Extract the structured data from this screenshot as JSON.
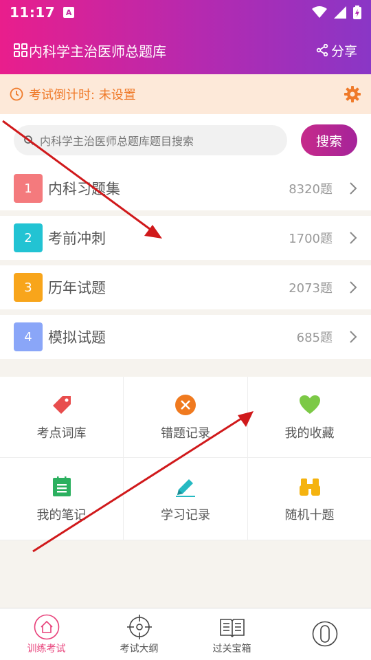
{
  "status_bar": {
    "time": "11:17",
    "a_badge": "A"
  },
  "header": {
    "title": "内科学主治医师总题库",
    "share_label": "分享"
  },
  "countdown": {
    "text": "考试倒计时: 未设置"
  },
  "search": {
    "placeholder": "内科学主治医师总题库题目搜索",
    "button": "搜索"
  },
  "categories": [
    {
      "num": "1",
      "label": "内科习题集",
      "count": "8320题",
      "color": "#f47a7d"
    },
    {
      "num": "2",
      "label": "考前冲刺",
      "count": "1700题",
      "color": "#22c3d3"
    },
    {
      "num": "3",
      "label": "历年试题",
      "count": "2073题",
      "color": "#f8a51b"
    },
    {
      "num": "4",
      "label": "模拟试题",
      "count": "685题",
      "color": "#8aa6f8"
    }
  ],
  "tools": [
    {
      "label": "考点词库",
      "icon": "tag-icon"
    },
    {
      "label": "错题记录",
      "icon": "close-circle-icon"
    },
    {
      "label": "我的收藏",
      "icon": "heart-icon"
    },
    {
      "label": "我的笔记",
      "icon": "notebook-icon"
    },
    {
      "label": "学习记录",
      "icon": "pencil-icon"
    },
    {
      "label": "随机十题",
      "icon": "binoculars-icon"
    }
  ],
  "bottom_nav": [
    {
      "label": "训练考试",
      "icon": "home-icon",
      "active": true
    },
    {
      "label": "考试大纲",
      "icon": "target-icon",
      "active": false
    },
    {
      "label": "过关宝箱",
      "icon": "book-icon",
      "active": false
    },
    {
      "label": "",
      "icon": "profile-icon",
      "active": false
    }
  ],
  "colors": {
    "accent": "#c62a8a",
    "countdown_text": "#ef7a2a",
    "countdown_bg": "#fde9d9",
    "nav_active": "#e8417a",
    "arrow": "#d0191b"
  }
}
